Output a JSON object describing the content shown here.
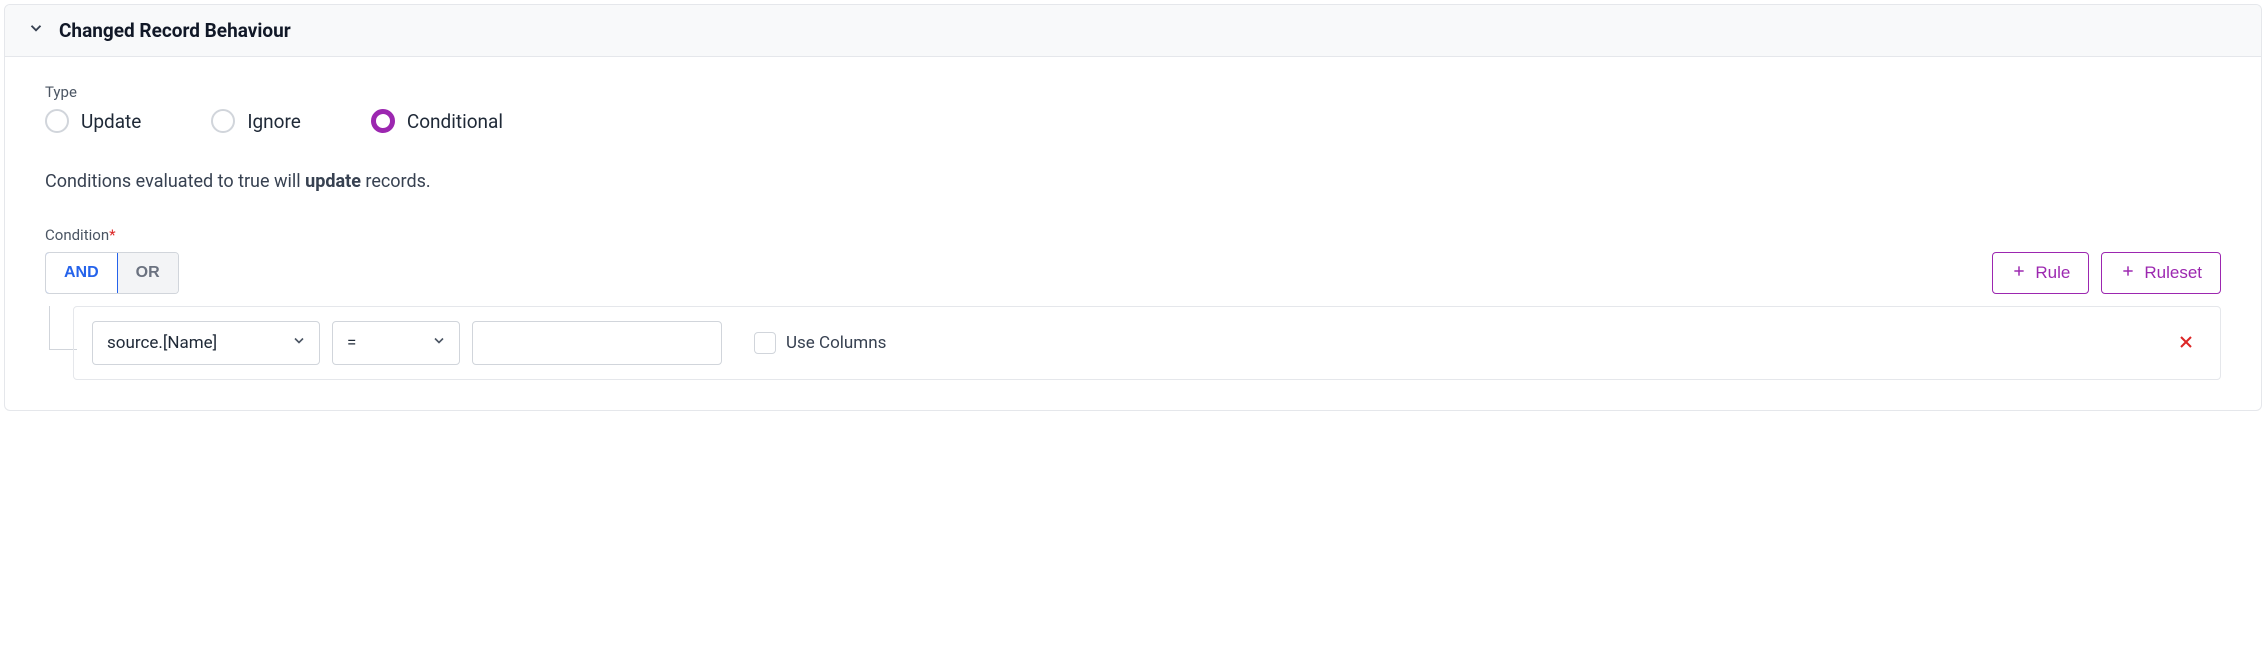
{
  "header": {
    "title": "Changed Record Behaviour"
  },
  "type": {
    "label": "Type",
    "options": {
      "update": "Update",
      "ignore": "Ignore",
      "conditional": "Conditional"
    },
    "selected": "conditional"
  },
  "hint": {
    "prefix": "Conditions evaluated to true will ",
    "bold": "update",
    "suffix": " records."
  },
  "condition": {
    "label": "Condition",
    "required_marker": "*",
    "logic": {
      "and": "AND",
      "or": "OR",
      "active": "and"
    },
    "buttons": {
      "rule": "Rule",
      "ruleset": "Ruleset"
    },
    "rule": {
      "field": "source.[Name]",
      "operator": "=",
      "value": "",
      "use_columns_label": "Use Columns",
      "use_columns_checked": false
    }
  }
}
